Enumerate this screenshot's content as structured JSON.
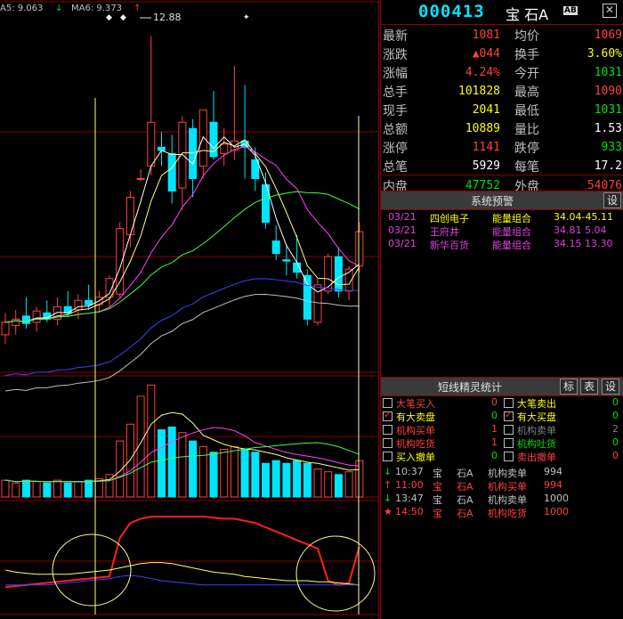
{
  "chart_header": {
    "ma_a_label": "A5: 9.063",
    "ma_b_label": "MA6: 9.373",
    "arrow_down": "↓",
    "arrow_up": "↑",
    "peak_label": "12.88"
  },
  "stock": {
    "code": "000413",
    "name": "宝 石A",
    "badge": "AB"
  },
  "quote": [
    {
      "l": "最新",
      "v": "1081",
      "vc": "#ff4040",
      "l2": "均价",
      "v2": "1069",
      "v2c": "#ff4040"
    },
    {
      "l": "涨跌",
      "v": "▲044",
      "vc": "#ff4040",
      "l2": "换手",
      "v2": "3.60%",
      "v2c": "#ffff00"
    },
    {
      "l": "涨幅",
      "v": "4.24%",
      "vc": "#ff4040",
      "l2": "今开",
      "v2": "1031",
      "v2c": "#00e000"
    },
    {
      "l": "总手",
      "v": "101828",
      "vc": "#ffff00",
      "l2": "最高",
      "v2": "1090",
      "v2c": "#ff4040"
    },
    {
      "l": "现手",
      "v": "2041",
      "vc": "#ffff00",
      "l2": "最低",
      "v2": "1031",
      "v2c": "#00e000"
    },
    {
      "l": "总额",
      "v": "10889",
      "vc": "#ffff00",
      "l2": "量比",
      "v2": "1.53",
      "v2c": "#ffffff"
    },
    {
      "l": "涨停",
      "v": "1141",
      "vc": "#ff4040",
      "l2": "跌停",
      "v2": "933",
      "v2c": "#00e000"
    },
    {
      "l": "总笔",
      "v": "5929",
      "vc": "#ffffff",
      "l2": "每笔",
      "v2": "17.2",
      "v2c": "#ffffff"
    },
    {
      "l": "内盘",
      "v": "47752",
      "vc": "#00e000",
      "l2": "外盘",
      "v2": "54076",
      "v2c": "#ff4040"
    }
  ],
  "alerts": {
    "title": "系统预警",
    "settings_label": "设",
    "rows": [
      {
        "date": "03/21",
        "name": "四创电子",
        "type": "能量组合",
        "range": "34.04-45.11"
      },
      {
        "date": "03/21",
        "name": "王府井",
        "type": "能量组合",
        "range": "34.81  5.04"
      },
      {
        "date": "03/21",
        "name": "新华百货",
        "type": "能量组合",
        "range": "34.15 13.30"
      }
    ]
  },
  "elf": {
    "title": "短线精灵统计",
    "btn_mark": "标",
    "btn_table": "表",
    "btn_settings": "设",
    "stats": [
      {
        "label": "大笔买入",
        "count": "0",
        "checked": false,
        "lc": "#ff4040",
        "cc": "#ff4040"
      },
      {
        "label": "大笔卖出",
        "count": "0",
        "checked": false,
        "lc": "#ffff00",
        "cc": "#00e000"
      },
      {
        "label": "有大卖盘",
        "count": "0",
        "checked": true,
        "lc": "#ffff00",
        "cc": "#00e000"
      },
      {
        "label": "有大买盘",
        "count": "0",
        "checked": true,
        "lc": "#ffff00",
        "cc": "#00e000"
      },
      {
        "label": "机构买单",
        "count": "1",
        "checked": false,
        "lc": "#ff4040",
        "cc": "#ff4040"
      },
      {
        "label": "机构卖单",
        "count": "2",
        "checked": false,
        "lc": "#808080",
        "cc": "#808080"
      },
      {
        "label": "机构吃货",
        "count": "1",
        "checked": false,
        "lc": "#ff4040",
        "cc": "#ff4040"
      },
      {
        "label": "机构吐货",
        "count": "0",
        "checked": false,
        "lc": "#00e000",
        "cc": "#00e000"
      },
      {
        "label": "买入撤单",
        "count": "0",
        "checked": false,
        "lc": "#ffff00",
        "cc": "#00e000"
      },
      {
        "label": "卖出撤单",
        "count": "0",
        "checked": false,
        "lc": "#ff4040",
        "cc": "#ff4040"
      }
    ],
    "ticks": [
      {
        "arrow": "↓",
        "ac": "#00e000",
        "time": "10:37",
        "s1": "宝",
        "s2": "石A",
        "event": "机构卖单",
        "vol": "994",
        "c": "#c0c0c0"
      },
      {
        "arrow": "↑",
        "ac": "#ff4040",
        "time": "11:00",
        "s1": "宝",
        "s2": "石A",
        "event": "机构买单",
        "vol": "994",
        "c": "#ff4040"
      },
      {
        "arrow": "↓",
        "ac": "#00e000",
        "time": "13:47",
        "s1": "宝",
        "s2": "石A",
        "event": "机构卖单",
        "vol": "1000",
        "c": "#c0c0c0"
      },
      {
        "arrow": "★",
        "ac": "#ff4040",
        "time": "14:50",
        "s1": "宝",
        "s2": "石A",
        "event": "机构吃货",
        "vol": "1000",
        "c": "#ff4040"
      }
    ]
  },
  "chart_data": {
    "type": "candlestick",
    "grid": true,
    "price_range": [
      7.5,
      13.2
    ],
    "candles": [
      {
        "o": 8.1,
        "h": 8.45,
        "l": 7.95,
        "c": 8.3
      },
      {
        "o": 8.25,
        "h": 8.5,
        "l": 8.1,
        "c": 8.35
      },
      {
        "o": 8.4,
        "h": 8.7,
        "l": 8.2,
        "c": 8.28
      },
      {
        "o": 8.3,
        "h": 8.55,
        "l": 8.15,
        "c": 8.48
      },
      {
        "o": 8.45,
        "h": 8.65,
        "l": 8.3,
        "c": 8.35
      },
      {
        "o": 8.35,
        "h": 8.7,
        "l": 8.25,
        "c": 8.55
      },
      {
        "o": 8.55,
        "h": 8.8,
        "l": 8.4,
        "c": 8.45
      },
      {
        "o": 8.5,
        "h": 8.75,
        "l": 8.35,
        "c": 8.65
      },
      {
        "o": 8.65,
        "h": 8.9,
        "l": 8.5,
        "c": 8.58
      },
      {
        "o": 8.58,
        "h": 8.8,
        "l": 8.45,
        "c": 8.7
      },
      {
        "o": 8.7,
        "h": 9.05,
        "l": 8.55,
        "c": 9.0
      },
      {
        "o": 8.75,
        "h": 9.9,
        "l": 8.7,
        "c": 9.8
      },
      {
        "o": 9.7,
        "h": 10.4,
        "l": 9.5,
        "c": 10.3
      },
      {
        "o": 10.6,
        "h": 10.75,
        "l": 10.55,
        "c": 10.6
      },
      {
        "o": 10.8,
        "h": 12.88,
        "l": 10.65,
        "c": 11.5
      },
      {
        "o": 11.1,
        "h": 11.35,
        "l": 10.8,
        "c": 11.05
      },
      {
        "o": 11.0,
        "h": 11.3,
        "l": 10.2,
        "c": 10.4
      },
      {
        "o": 10.45,
        "h": 11.6,
        "l": 10.1,
        "c": 11.5
      },
      {
        "o": 11.4,
        "h": 11.55,
        "l": 10.3,
        "c": 10.6
      },
      {
        "o": 10.8,
        "h": 11.7,
        "l": 10.6,
        "c": 11.7
      },
      {
        "o": 11.5,
        "h": 12.0,
        "l": 10.9,
        "c": 10.95
      },
      {
        "o": 11.0,
        "h": 11.4,
        "l": 10.8,
        "c": 11.15
      },
      {
        "o": 11.05,
        "h": 12.4,
        "l": 10.9,
        "c": 11.2
      },
      {
        "o": 11.2,
        "h": 12.1,
        "l": 10.6,
        "c": 11.1
      },
      {
        "o": 10.9,
        "h": 11.1,
        "l": 10.4,
        "c": 10.6
      },
      {
        "o": 10.5,
        "h": 10.7,
        "l": 9.8,
        "c": 9.9
      },
      {
        "o": 9.6,
        "h": 9.85,
        "l": 9.3,
        "c": 9.4
      },
      {
        "o": 9.3,
        "h": 9.55,
        "l": 9.05,
        "c": 9.28
      },
      {
        "o": 9.25,
        "h": 9.7,
        "l": 9.0,
        "c": 9.1
      },
      {
        "o": 9.05,
        "h": 9.15,
        "l": 8.25,
        "c": 8.35
      },
      {
        "o": 8.3,
        "h": 9.0,
        "l": 8.25,
        "c": 8.9
      },
      {
        "o": 8.8,
        "h": 9.4,
        "l": 8.75,
        "c": 9.35
      },
      {
        "o": 9.35,
        "h": 9.5,
        "l": 8.7,
        "c": 8.8
      },
      {
        "o": 8.8,
        "h": 9.2,
        "l": 8.65,
        "c": 9.15
      },
      {
        "o": 9.2,
        "h": 9.9,
        "l": 9.1,
        "c": 9.75
      }
    ],
    "volume": [
      0.6,
      0.5,
      0.6,
      0.55,
      0.5,
      0.6,
      0.5,
      0.55,
      0.6,
      0.65,
      0.8,
      2.0,
      2.6,
      3.6,
      4.0,
      2.4,
      2.5,
      2.3,
      2.0,
      1.8,
      1.6,
      1.7,
      1.8,
      1.7,
      1.6,
      1.2,
      1.3,
      1.2,
      1.3,
      1.2,
      1.0,
      0.9,
      0.8,
      0.9,
      1.3
    ]
  },
  "colors": {
    "up": "#ff4040",
    "down": "#00e5ff",
    "grid": "#8a0000",
    "ma1": "#ffffff",
    "ma2": "#ffff80",
    "ma3": "#ff40ff",
    "ma4": "#40ff40",
    "ma5": "#4040ff",
    "ma6": "#c0c0c0"
  }
}
